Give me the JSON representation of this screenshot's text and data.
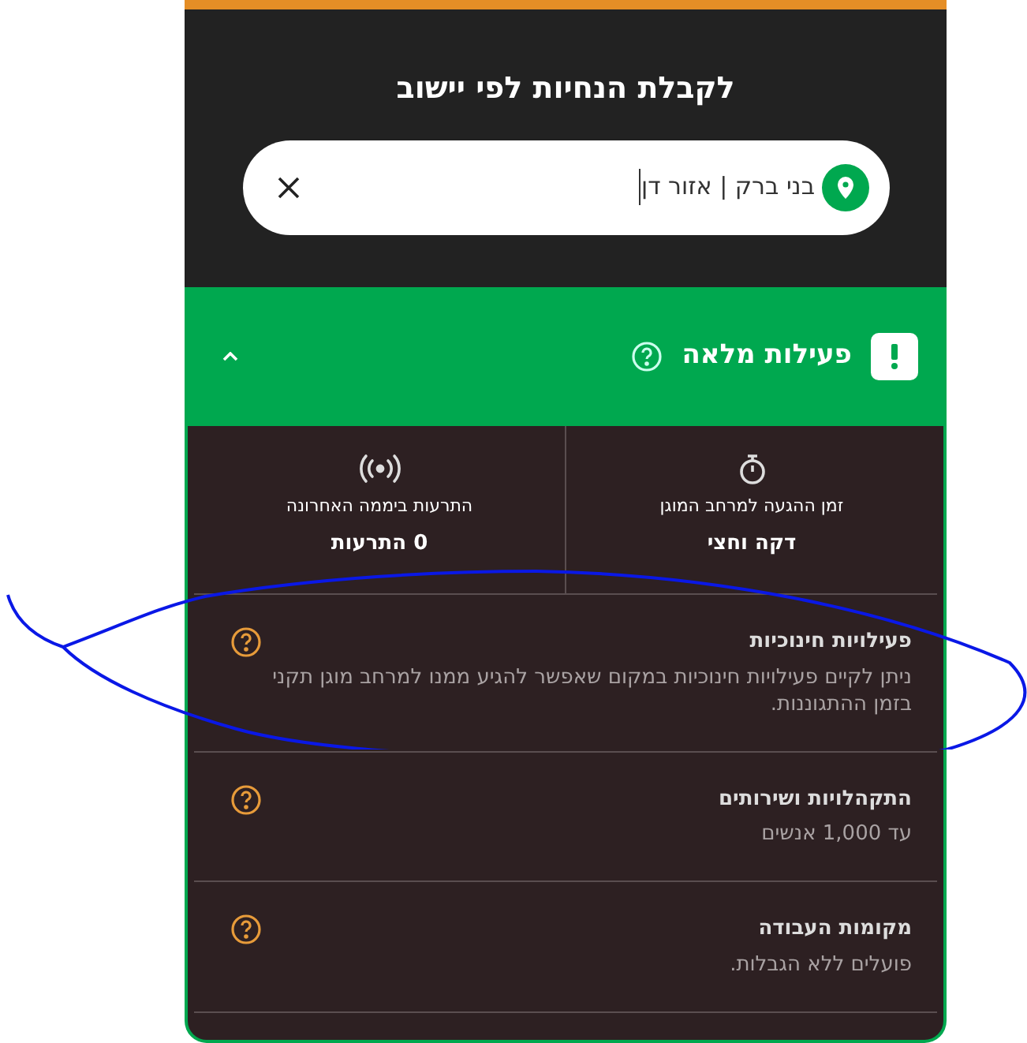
{
  "header": {
    "title": "לקבלת הנחיות לפי יישוב",
    "search": {
      "value": "בני ברק | אזור דן"
    }
  },
  "status": {
    "title": "פעילות מלאה",
    "expanded": true
  },
  "stats": [
    {
      "kind": "timer",
      "label": "זמן ההגעה למרחב המוגן",
      "value": "דקה וחצי"
    },
    {
      "kind": "alerts",
      "label": "התרעות ביממה האחרונה",
      "value": "0 התרעות"
    }
  ],
  "guidelines": [
    {
      "title": "פעילויות חינוכיות",
      "text": "ניתן לקיים פעילויות חינוכיות במקום שאפשר להגיע ממנו למרחב מוגן תקני בזמן ההתגוננות."
    },
    {
      "title": "התקהלויות ושירותים",
      "text": "עד 1,000 אנשים"
    },
    {
      "title": "מקומות העבודה",
      "text": "פועלים ללא הגבלות."
    }
  ]
}
